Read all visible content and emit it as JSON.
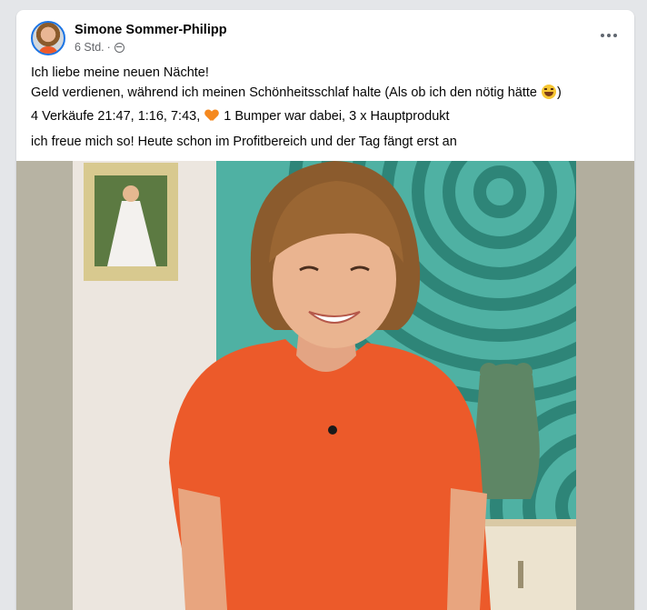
{
  "post": {
    "author": "Simone Sommer-Philipp",
    "time": "6 Std.",
    "separator": "·",
    "lines": {
      "line1": "Ich liebe meine neuen Nächte!",
      "line2_before": "Geld verdienen, während ich meinen Schönheitsschlaf halte (Als ob ich den nötig hätte",
      "line2_after": ")",
      "line3_before": "4 Verkäufe 21:47, 1:16, 7:43,",
      "line3_after": "1 Bumper war dabei, 3 x Hauptprodukt",
      "line4": "ich freue mich so! Heute schon im Profitbereich und der Tag fängt erst an"
    },
    "icons": {
      "privacy": "globe-icon",
      "more": "more-options-icon",
      "emoji1": "laughing-emoji-icon",
      "emoji2": "orange-heart-icon"
    }
  },
  "colors": {
    "accent": "#1b74e4",
    "shirt": "#ec5a2a",
    "wall_teal": "#4fb1a3"
  }
}
